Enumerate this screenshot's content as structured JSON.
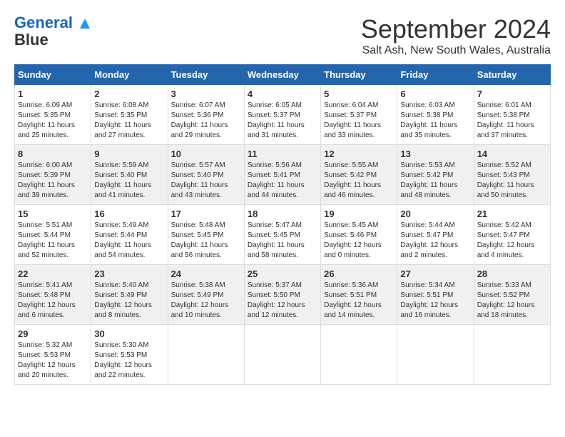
{
  "header": {
    "logo_line1": "General",
    "logo_line2": "Blue",
    "title": "September 2024",
    "subtitle": "Salt Ash, New South Wales, Australia"
  },
  "calendar": {
    "weekdays": [
      "Sunday",
      "Monday",
      "Tuesday",
      "Wednesday",
      "Thursday",
      "Friday",
      "Saturday"
    ],
    "weeks": [
      [
        {
          "day": "",
          "info": ""
        },
        {
          "day": "2",
          "info": "Sunrise: 6:08 AM\nSunset: 5:35 PM\nDaylight: 11 hours\nand 27 minutes."
        },
        {
          "day": "3",
          "info": "Sunrise: 6:07 AM\nSunset: 5:36 PM\nDaylight: 11 hours\nand 29 minutes."
        },
        {
          "day": "4",
          "info": "Sunrise: 6:05 AM\nSunset: 5:37 PM\nDaylight: 11 hours\nand 31 minutes."
        },
        {
          "day": "5",
          "info": "Sunrise: 6:04 AM\nSunset: 5:37 PM\nDaylight: 11 hours\nand 33 minutes."
        },
        {
          "day": "6",
          "info": "Sunrise: 6:03 AM\nSunset: 5:38 PM\nDaylight: 11 hours\nand 35 minutes."
        },
        {
          "day": "7",
          "info": "Sunrise: 6:01 AM\nSunset: 5:38 PM\nDaylight: 11 hours\nand 37 minutes."
        }
      ],
      [
        {
          "day": "1",
          "info": "Sunrise: 6:09 AM\nSunset: 5:35 PM\nDaylight: 11 hours\nand 25 minutes."
        },
        {
          "day": "",
          "info": ""
        },
        {
          "day": "",
          "info": ""
        },
        {
          "day": "",
          "info": ""
        },
        {
          "day": "",
          "info": ""
        },
        {
          "day": "",
          "info": ""
        },
        {
          "day": "",
          "info": ""
        }
      ],
      [
        {
          "day": "8",
          "info": "Sunrise: 6:00 AM\nSunset: 5:39 PM\nDaylight: 11 hours\nand 39 minutes."
        },
        {
          "day": "9",
          "info": "Sunrise: 5:59 AM\nSunset: 5:40 PM\nDaylight: 11 hours\nand 41 minutes."
        },
        {
          "day": "10",
          "info": "Sunrise: 5:57 AM\nSunset: 5:40 PM\nDaylight: 11 hours\nand 43 minutes."
        },
        {
          "day": "11",
          "info": "Sunrise: 5:56 AM\nSunset: 5:41 PM\nDaylight: 11 hours\nand 44 minutes."
        },
        {
          "day": "12",
          "info": "Sunrise: 5:55 AM\nSunset: 5:42 PM\nDaylight: 11 hours\nand 46 minutes."
        },
        {
          "day": "13",
          "info": "Sunrise: 5:53 AM\nSunset: 5:42 PM\nDaylight: 11 hours\nand 48 minutes."
        },
        {
          "day": "14",
          "info": "Sunrise: 5:52 AM\nSunset: 5:43 PM\nDaylight: 11 hours\nand 50 minutes."
        }
      ],
      [
        {
          "day": "15",
          "info": "Sunrise: 5:51 AM\nSunset: 5:44 PM\nDaylight: 11 hours\nand 52 minutes."
        },
        {
          "day": "16",
          "info": "Sunrise: 5:49 AM\nSunset: 5:44 PM\nDaylight: 11 hours\nand 54 minutes."
        },
        {
          "day": "17",
          "info": "Sunrise: 5:48 AM\nSunset: 5:45 PM\nDaylight: 11 hours\nand 56 minutes."
        },
        {
          "day": "18",
          "info": "Sunrise: 5:47 AM\nSunset: 5:45 PM\nDaylight: 11 hours\nand 58 minutes."
        },
        {
          "day": "19",
          "info": "Sunrise: 5:45 AM\nSunset: 5:46 PM\nDaylight: 12 hours\nand 0 minutes."
        },
        {
          "day": "20",
          "info": "Sunrise: 5:44 AM\nSunset: 5:47 PM\nDaylight: 12 hours\nand 2 minutes."
        },
        {
          "day": "21",
          "info": "Sunrise: 5:42 AM\nSunset: 5:47 PM\nDaylight: 12 hours\nand 4 minutes."
        }
      ],
      [
        {
          "day": "22",
          "info": "Sunrise: 5:41 AM\nSunset: 5:48 PM\nDaylight: 12 hours\nand 6 minutes."
        },
        {
          "day": "23",
          "info": "Sunrise: 5:40 AM\nSunset: 5:49 PM\nDaylight: 12 hours\nand 8 minutes."
        },
        {
          "day": "24",
          "info": "Sunrise: 5:38 AM\nSunset: 5:49 PM\nDaylight: 12 hours\nand 10 minutes."
        },
        {
          "day": "25",
          "info": "Sunrise: 5:37 AM\nSunset: 5:50 PM\nDaylight: 12 hours\nand 12 minutes."
        },
        {
          "day": "26",
          "info": "Sunrise: 5:36 AM\nSunset: 5:51 PM\nDaylight: 12 hours\nand 14 minutes."
        },
        {
          "day": "27",
          "info": "Sunrise: 5:34 AM\nSunset: 5:51 PM\nDaylight: 12 hours\nand 16 minutes."
        },
        {
          "day": "28",
          "info": "Sunrise: 5:33 AM\nSunset: 5:52 PM\nDaylight: 12 hours\nand 18 minutes."
        }
      ],
      [
        {
          "day": "29",
          "info": "Sunrise: 5:32 AM\nSunset: 5:53 PM\nDaylight: 12 hours\nand 20 minutes."
        },
        {
          "day": "30",
          "info": "Sunrise: 5:30 AM\nSunset: 5:53 PM\nDaylight: 12 hours\nand 22 minutes."
        },
        {
          "day": "",
          "info": ""
        },
        {
          "day": "",
          "info": ""
        },
        {
          "day": "",
          "info": ""
        },
        {
          "day": "",
          "info": ""
        },
        {
          "day": "",
          "info": ""
        }
      ]
    ]
  }
}
